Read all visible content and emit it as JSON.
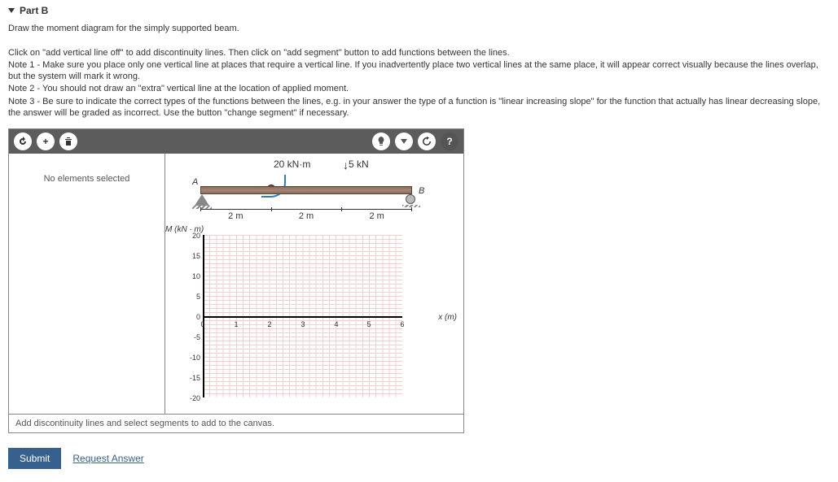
{
  "part": {
    "label": "Part B"
  },
  "instructions": {
    "line1": "Draw the moment diagram for the simply supported beam.",
    "line2": "Click on \"add vertical line off\" to add discontinuity lines. Then click on \"add segment\" button to add functions between the lines.",
    "note1": "Note 1 - Make sure you place only one vertical line at places that require a vertical line. If you inadvertently place two vertical lines at the same place, it will appear correct visually because the lines overlap, but the system will mark it wrong.",
    "note2": "Note 2 - You should not draw an \"extra\" vertical line at the location of applied moment.",
    "note3": "Note 3 - Be sure to indicate the correct types of the functions between the lines, e.g. in your answer the type of a function is \"linear increasing slope\" for the function that actually has linear decreasing slope, the answer will be graded as incorrect. Use the button \"change segment\" if necessary."
  },
  "sidebar": {
    "no_selection": "No elements selected"
  },
  "beam": {
    "moment_load": "20 kN·m",
    "force_load": "5 kN",
    "point_A": "A",
    "point_B": "B",
    "seg1": "2 m",
    "seg2": "2 m",
    "seg3": "2 m"
  },
  "chart_data": {
    "type": "line",
    "title": "",
    "ylabel": "M (kN · m)",
    "xlabel": "x (m)",
    "xlim": [
      0,
      6
    ],
    "ylim": [
      -20,
      20
    ],
    "yticks": [
      -20,
      -15,
      -10,
      -5,
      0,
      5,
      10,
      15,
      20
    ],
    "xticks": [
      0,
      1,
      2,
      3,
      4,
      5,
      6
    ],
    "series": []
  },
  "status": {
    "hint": "Add discontinuity lines and select segments to add to the canvas."
  },
  "footer": {
    "submit": "Submit",
    "request": "Request Answer"
  }
}
